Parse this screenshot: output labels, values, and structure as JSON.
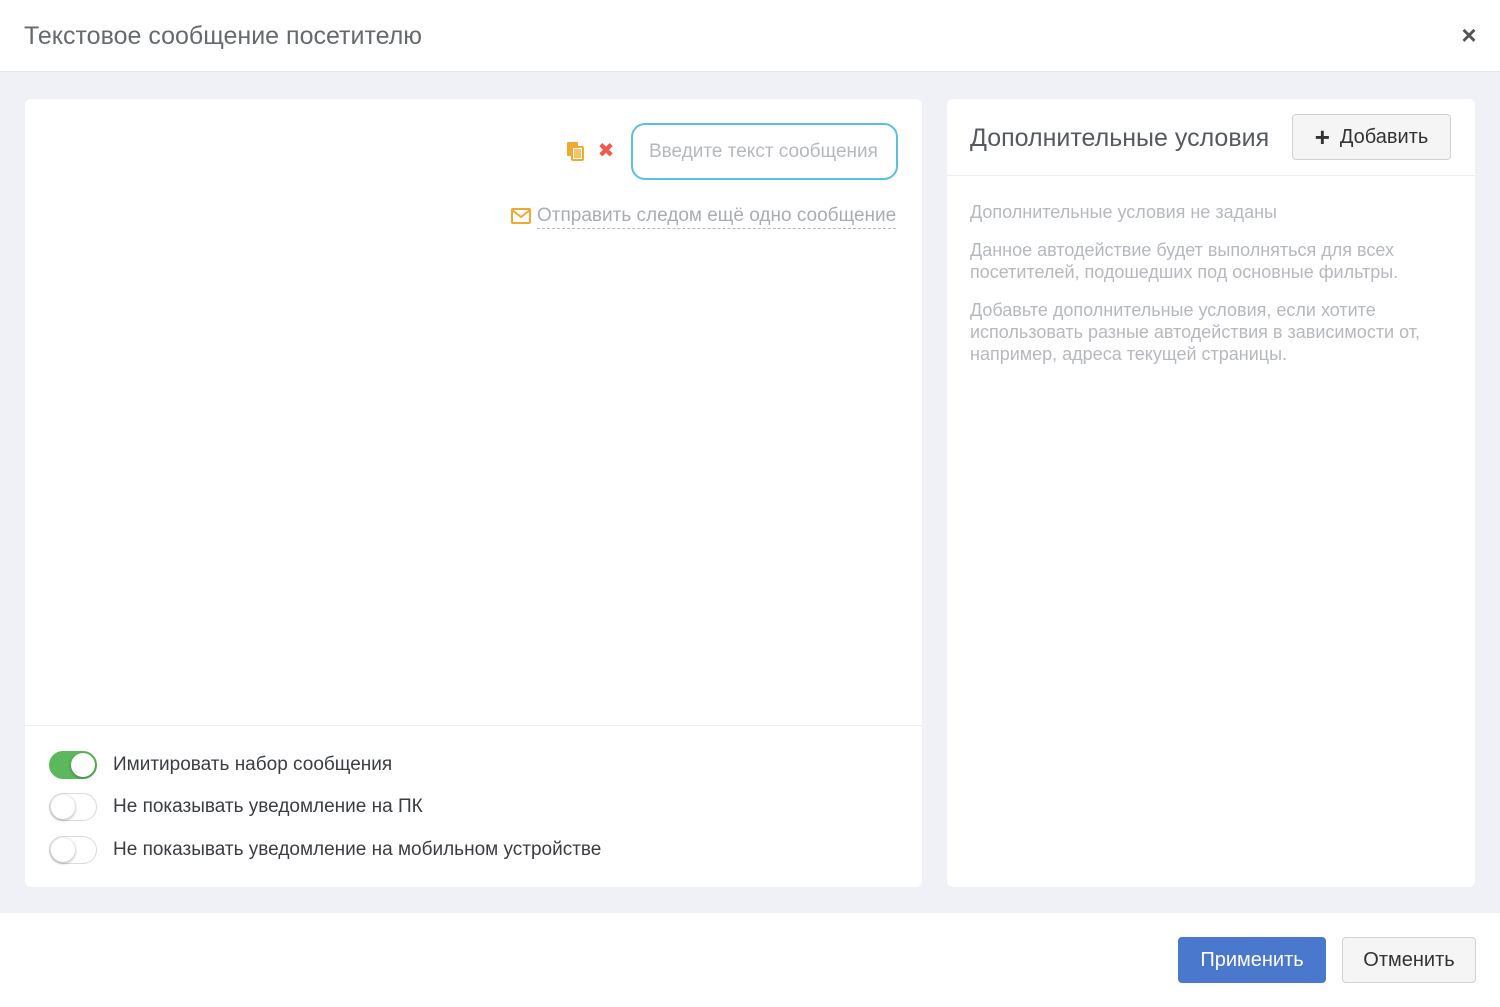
{
  "modal": {
    "title": "Текстовое сообщение посетителю",
    "close_icon": "close-icon"
  },
  "message_editor": {
    "copy_icon": "copy-icon",
    "remove_icon": "remove-icon",
    "input_placeholder": "Введите текст сообщения",
    "input_value": "",
    "send_next_icon": "envelope-icon",
    "send_next_label": "Отправить следом ещё одно сообщение",
    "accent_color": "#f0a830",
    "input_border_color": "#5bc0de"
  },
  "toggles": [
    {
      "label": "Имитировать набор сообщения",
      "on": true
    },
    {
      "label": "Не показывать уведомление на ПК",
      "on": false
    },
    {
      "label": "Не показывать уведомление на мобильном устройстве",
      "on": false
    }
  ],
  "conditions": {
    "title": "Дополнительные условия",
    "add_icon": "plus-icon",
    "add_label": "Добавить",
    "empty_title": "Дополнительные условия не заданы",
    "info_1": "Данное автодействие будет выполняться для всех посетителей, подошедших под основные фильтры.",
    "info_2": "Добавьте дополнительные условия, если хотите использовать разные автодействия в зависимости от, например, адреса текущей страницы."
  },
  "footer": {
    "apply_label": "Применить",
    "cancel_label": "Отменить",
    "apply_color": "#4a78cc",
    "toggle_on_color": "#5cb85c"
  }
}
